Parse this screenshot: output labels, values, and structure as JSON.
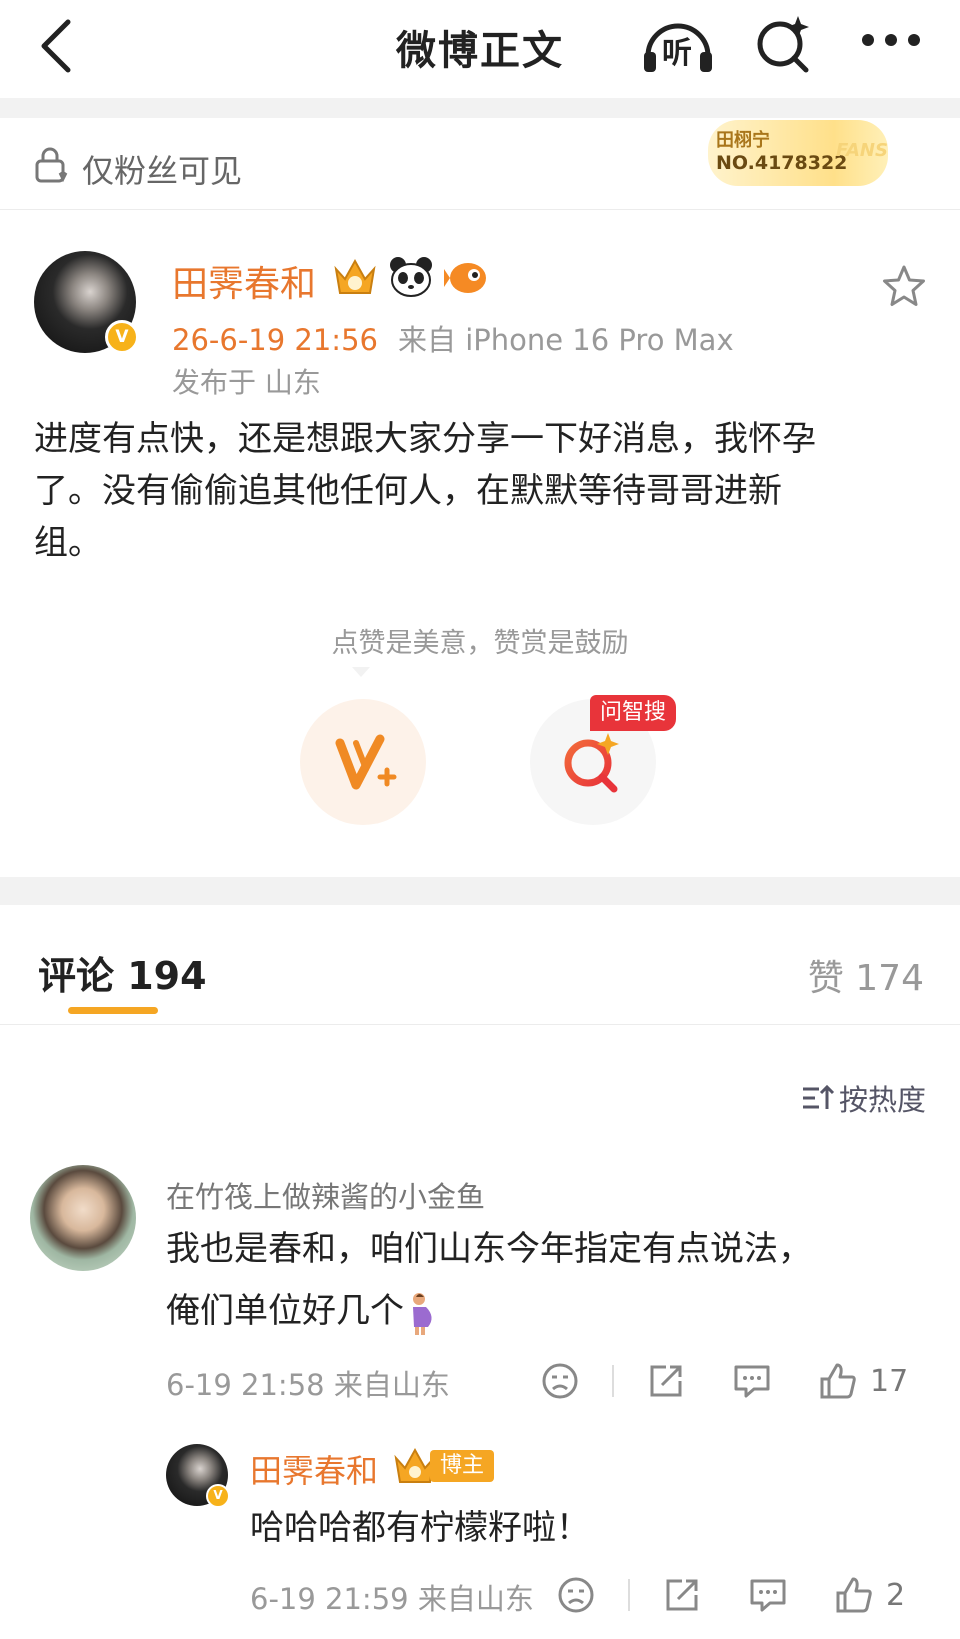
{
  "topbar": {
    "title": "微博正文",
    "listen_label": "听"
  },
  "visibility": {
    "label": "仅粉丝可见"
  },
  "fan_badge": {
    "name": "田栩宁",
    "number": "NO.4178322",
    "tag": "FANS"
  },
  "post": {
    "author": "田霁春和",
    "verified_mark": "V",
    "time": "26-6-19 21:56",
    "source": "来自 iPhone 16 Pro Max",
    "location": "发布于 山东",
    "text_lines": [
      "进度有点快，还是想跟大家分享一下好消息，我怀孕",
      "了。没有偷偷追其他任何人，在默默等待哥哥进新",
      "组。"
    ],
    "reward_tip": "点赞是美意，赞赏是鼓励",
    "ask_ai_tag": "问智搜"
  },
  "tabs": {
    "comments": "评论 194",
    "likes": "赞 174"
  },
  "sort": {
    "label": "按热度"
  },
  "comment": {
    "author": "在竹筏上做辣酱的小金鱼",
    "text_line1": "我也是春和，咱们山东今年指定有点说法，",
    "text_line2": "俺们单位好几个",
    "time_source": "6-19 21:58  来自山东",
    "likes": "17"
  },
  "reply": {
    "author": "田霁春和",
    "verified_mark": "V",
    "badge": "博主",
    "text": "哈哈哈都有柠檬籽啦！",
    "time_source": "6-19 21:59  来自山东",
    "likes": "2"
  },
  "colors": {
    "accent_orange": "#e8772e",
    "badge_gold": "#f5a623",
    "ai_red": "#e8343a"
  }
}
